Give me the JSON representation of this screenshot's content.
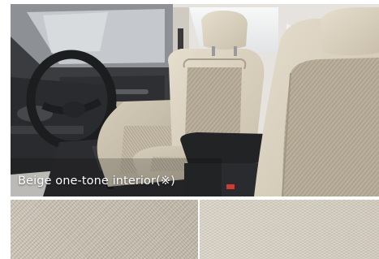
{
  "caption": "Beige one-tone interior(※)",
  "colors": {
    "seat_beige": "#cfc6b3",
    "seat_fabric": "#b7ad99",
    "dash_dark": "#2b2c2f",
    "window_light": "#eef0f1"
  },
  "swatches": [
    {
      "name": "beige-leatherette-swatch"
    },
    {
      "name": "beige-fabric-swatch"
    }
  ]
}
